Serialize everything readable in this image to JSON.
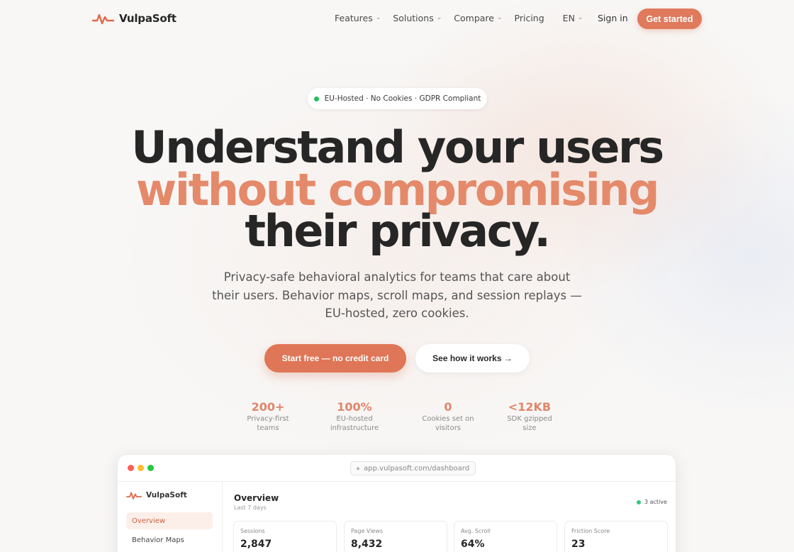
{
  "nav": {
    "brand": "VulpaSoft",
    "links": [
      {
        "label": "Features",
        "dropdown": true
      },
      {
        "label": "Solutions",
        "dropdown": true
      },
      {
        "label": "Compare",
        "dropdown": true
      },
      {
        "label": "Pricing",
        "dropdown": false
      },
      {
        "label": "EN",
        "dropdown": true
      }
    ],
    "sign_in": "Sign in",
    "cta": "Get started"
  },
  "badge": {
    "text": "EU-Hosted · No Cookies · GDPR Compliant",
    "dot_color": "#22c05a"
  },
  "hero": {
    "line1": "Understand your users",
    "line2": "without compromising",
    "line3": "their privacy.",
    "subtitle": "Privacy-safe behavioral analytics for teams that care about their users. Behavior maps, scroll maps, and session replays — EU-hosted, zero cookies.",
    "primary_cta": "Start free — no credit card",
    "secondary_cta": "See how it works →"
  },
  "stats": [
    {
      "value": "200+",
      "label": "Privacy-first teams"
    },
    {
      "value": "100%",
      "label": "EU-hosted infrastructure"
    },
    {
      "value": "0",
      "label": "Cookies set on visitors"
    },
    {
      "value": "<12KB",
      "label": "SDK gzipped size"
    }
  ],
  "preview": {
    "url": "app.vulpasoft.com/dashboard",
    "brand": "VulpaSoft",
    "sidebar": [
      {
        "label": "Overview"
      },
      {
        "label": "Behavior Maps"
      }
    ],
    "title": "Overview",
    "period": "Last 7 days",
    "active": "3 active",
    "cards": [
      {
        "label": "Sessions",
        "value": "2,847"
      },
      {
        "label": "Page Views",
        "value": "8,432"
      },
      {
        "label": "Avg. Scroll",
        "value": "64%"
      },
      {
        "label": "Friction Score",
        "value": "23"
      }
    ]
  },
  "colors": {
    "accent": "#df7a5d",
    "headline_accent": "#e48a6a",
    "text": "#262626"
  }
}
